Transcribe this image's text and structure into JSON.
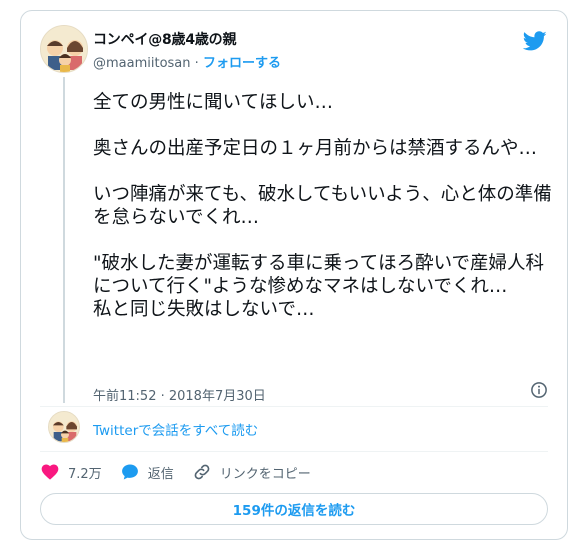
{
  "author": {
    "display_name": "コンペイ@8歳4歳の親",
    "handle": "@maamiitosan",
    "separator": "·",
    "follow_label": "フォローする"
  },
  "tweet": {
    "paragraphs": [
      "全ての男性に聞いてほしい…",
      "奥さんの出産予定日の１ヶ月前からは禁酒するんや…",
      "いつ陣痛が来ても、破水してもいいよう、心と体の準備を怠らないでくれ…",
      "\"破水した妻が運転する車に乗ってほろ酔いで産婦人科について行く\"ような惨めなマネはしないでくれ…\n私と同じ失敗はしないで…"
    ],
    "timestamp": "午前11:52 · 2018年7月30日"
  },
  "conversation": {
    "link_label": "Twitterで会話をすべて読む"
  },
  "actions": {
    "like_count": "7.2万",
    "reply_label": "返信",
    "copy_link_label": "リンクをコピー"
  },
  "read_replies_label": "159件の返信を読む",
  "colors": {
    "accent": "#1d9bf0",
    "like": "#f91880",
    "text": "#0f1419",
    "muted": "#536471",
    "border": "#cfd9de"
  },
  "icons": [
    "twitter-bird-icon",
    "info-icon",
    "heart-icon",
    "reply-bubble-icon",
    "link-icon"
  ]
}
